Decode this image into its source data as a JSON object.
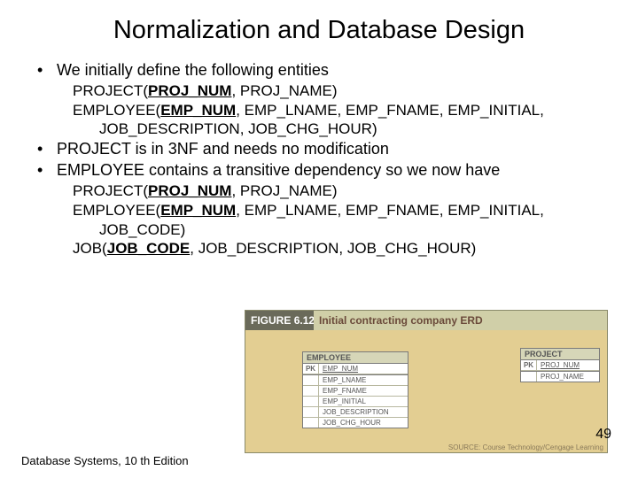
{
  "title": "Normalization and Database Design",
  "bullets": {
    "b1": "We initially define the following entities",
    "s1a_pre": "PROJECT(",
    "s1a_key": "PROJ_NUM",
    "s1a_post": ", PROJ_NAME)",
    "s1b_pre": "EMPLOYEE(",
    "s1b_key": "EMP_NUM",
    "s1b_post": ", EMP_LNAME, EMP_FNAME, EMP_INITIAL,",
    "s1c": "JOB_DESCRIPTION, JOB_CHG_HOUR)",
    "b2": "PROJECT is in 3NF and needs no modification",
    "b3": "EMPLOYEE contains a transitive dependency so we now have",
    "s3a_pre": "PROJECT(",
    "s3a_key": "PROJ_NUM",
    "s3a_post": ", PROJ_NAME)",
    "s3b_pre": "EMPLOYEE(",
    "s3b_key": "EMP_NUM",
    "s3b_post": ", EMP_LNAME, EMP_FNAME, EMP_INITIAL,",
    "s3c": "JOB_CODE)",
    "s3d_pre": "JOB(",
    "s3d_key": "JOB_CODE",
    "s3d_post": ", JOB_DESCRIPTION, JOB_CHG_HOUR)"
  },
  "figure": {
    "label": "FIGURE",
    "num": "6.12",
    "caption": "Initial contracting company ERD",
    "emp": {
      "title": "EMPLOYEE",
      "pk": "PK",
      "pkcol": "EMP_NUM",
      "c1": "EMP_LNAME",
      "c2": "EMP_FNAME",
      "c3": "EMP_INITIAL",
      "c4": "JOB_DESCRIPTION",
      "c5": "JOB_CHG_HOUR"
    },
    "proj": {
      "title": "PROJECT",
      "pk": "PK",
      "pkcol": "PROJ_NUM",
      "c1": "PROJ_NAME"
    },
    "source": "SOURCE: Course Technology/Cengage Learning"
  },
  "page": "49",
  "footer": "Database Systems, 10 th Edition"
}
